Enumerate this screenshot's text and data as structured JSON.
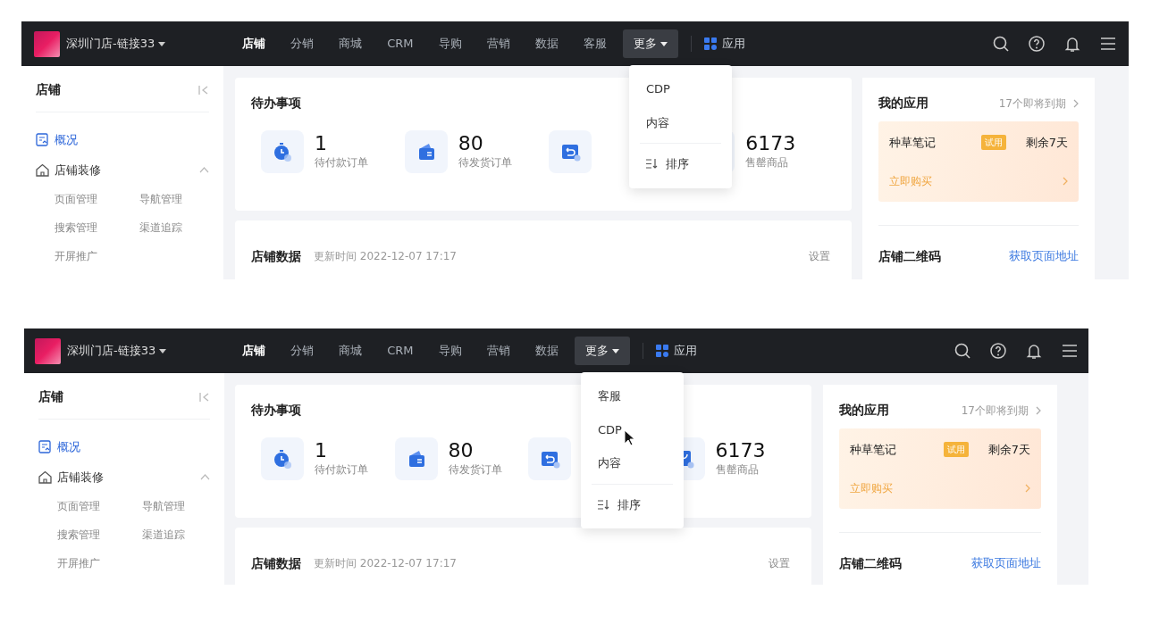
{
  "screens": [
    {
      "cursor_shown": false,
      "brand": {
        "name": "深圳门店-链接33"
      },
      "nav": [
        {
          "label": "店铺",
          "selected": true
        },
        {
          "label": "分销",
          "selected": false
        },
        {
          "label": "商城",
          "selected": false
        },
        {
          "label": "CRM",
          "selected": false
        },
        {
          "label": "导购",
          "selected": false
        },
        {
          "label": "营销",
          "selected": false
        },
        {
          "label": "数据",
          "selected": false
        },
        {
          "label": "客服",
          "selected": false
        }
      ],
      "more": {
        "label": "更多",
        "expanded": true,
        "items": [
          {
            "kind": "item",
            "label": "CDP"
          },
          {
            "kind": "item",
            "label": "内容"
          },
          {
            "kind": "sort",
            "label": "排序"
          }
        ]
      },
      "apps": {
        "label": "应用"
      },
      "sidebar": {
        "title": "店铺",
        "items": [
          {
            "label": "概况",
            "selected": true
          },
          {
            "label": "店铺装修",
            "selected": false,
            "expanded": true,
            "children": [
              {
                "label": "页面管理"
              },
              {
                "label": "导航管理"
              },
              {
                "label": "搜索管理"
              },
              {
                "label": "渠道追踪"
              },
              {
                "label": "开屏推广"
              }
            ]
          }
        ]
      },
      "todo": {
        "title": "待办事项",
        "stats": [
          {
            "kind": "stat",
            "value": "1",
            "label": "待付款订单"
          },
          {
            "kind": "stat",
            "value": "80",
            "label": "待发货订单"
          },
          {
            "kind": "covered"
          },
          {
            "kind": "stat",
            "value": "6173",
            "label": "售罄商品"
          }
        ]
      },
      "store_data": {
        "title": "店铺数据",
        "updated": "更新时间 2022-12-07 17:17",
        "action": "设置"
      },
      "my_apps": {
        "title": "我的应用",
        "expiring": "17个即将到期",
        "items": [
          {
            "name": "种草笔记",
            "badge": "试用",
            "remaining": "剩余7天",
            "action": "立即购买"
          }
        ]
      },
      "qr": {
        "title": "店铺二维码",
        "action": "获取页面地址"
      }
    },
    {
      "cursor_shown": true,
      "brand": {
        "name": "深圳门店-链接33"
      },
      "nav": [
        {
          "label": "店铺",
          "selected": true
        },
        {
          "label": "分销",
          "selected": false
        },
        {
          "label": "商城",
          "selected": false
        },
        {
          "label": "CRM",
          "selected": false
        },
        {
          "label": "导购",
          "selected": false
        },
        {
          "label": "营销",
          "selected": false
        },
        {
          "label": "数据",
          "selected": false
        }
      ],
      "more": {
        "label": "更多",
        "expanded": true,
        "items": [
          {
            "kind": "item",
            "label": "客服"
          },
          {
            "kind": "item",
            "label": "CDP"
          },
          {
            "kind": "item",
            "label": "内容"
          },
          {
            "kind": "sort",
            "label": "排序"
          }
        ]
      },
      "apps": {
        "label": "应用"
      },
      "sidebar": {
        "title": "店铺",
        "items": [
          {
            "label": "概况",
            "selected": true
          },
          {
            "label": "店铺装修",
            "selected": false,
            "expanded": true,
            "children": [
              {
                "label": "页面管理"
              },
              {
                "label": "导航管理"
              },
              {
                "label": "搜索管理"
              },
              {
                "label": "渠道追踪"
              },
              {
                "label": "开屏推广"
              }
            ]
          }
        ]
      },
      "todo": {
        "title": "待办事项",
        "stats": [
          {
            "kind": "stat",
            "value": "1",
            "label": "待付款订单"
          },
          {
            "kind": "stat",
            "value": "80",
            "label": "待发货订单"
          },
          {
            "kind": "covered"
          },
          {
            "kind": "stat",
            "value": "6173",
            "label": "售罄商品"
          }
        ]
      },
      "store_data": {
        "title": "店铺数据",
        "updated": "更新时间 2022-12-07 17:17",
        "action": "设置"
      },
      "my_apps": {
        "title": "我的应用",
        "expiring": "17个即将到期",
        "items": [
          {
            "name": "种草笔记",
            "badge": "试用",
            "remaining": "剩余7天",
            "action": "立即购买"
          }
        ]
      },
      "qr": {
        "title": "店铺二维码",
        "action": "获取页面地址"
      }
    }
  ]
}
